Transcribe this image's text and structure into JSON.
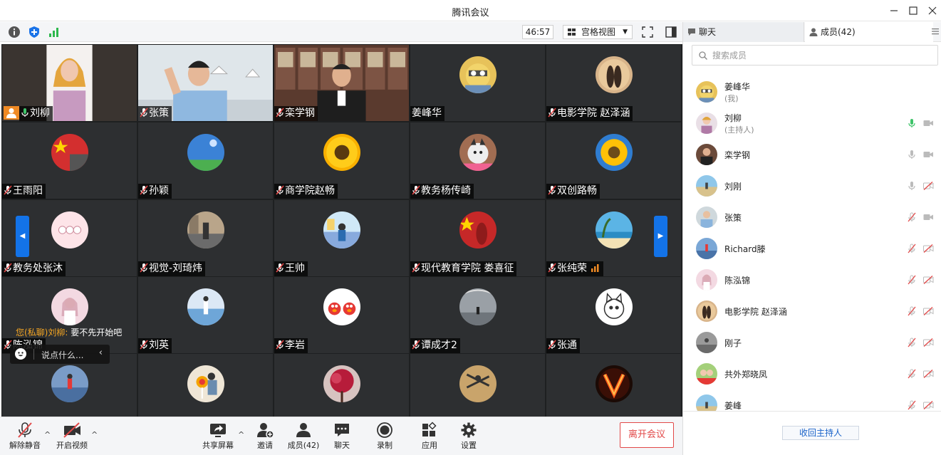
{
  "window": {
    "title": "腾讯会议"
  },
  "toolbar": {
    "timer": "46:57",
    "view_label": "宫格视图"
  },
  "tiles": [
    {
      "name": "刘柳",
      "row": 0,
      "col": 0,
      "video": "woman",
      "mic": "on",
      "host": true,
      "speaking": true
    },
    {
      "name": "张策",
      "row": 0,
      "col": 1,
      "video": "man-office",
      "mic": "muted"
    },
    {
      "name": "栾学钢",
      "row": 0,
      "col": 2,
      "video": "man-library",
      "mic": "muted"
    },
    {
      "name": "姜峰华",
      "row": 0,
      "col": 3,
      "avatar": "cartoon-yellow",
      "mic": "none"
    },
    {
      "name": "电影学院 赵泽涵",
      "row": 0,
      "col": 4,
      "avatar": "couple",
      "mic": "muted"
    },
    {
      "name": "王雨阳",
      "row": 1,
      "col": 0,
      "avatar": "flag",
      "mic": "muted"
    },
    {
      "name": "孙颖",
      "row": 1,
      "col": 1,
      "avatar": "sky-lawn",
      "mic": "muted"
    },
    {
      "name": "商学院赵畅",
      "row": 1,
      "col": 2,
      "avatar": "sunflower",
      "mic": "muted"
    },
    {
      "name": "教务杨传崎",
      "row": 1,
      "col": 3,
      "avatar": "husky",
      "mic": "muted"
    },
    {
      "name": "双创路畅",
      "row": 1,
      "col": 4,
      "avatar": "sunflower2",
      "mic": "muted"
    },
    {
      "name": "教务处张沐",
      "row": 2,
      "col": 0,
      "avatar": "cartoon-pink",
      "mic": "muted"
    },
    {
      "name": "视觉-刘琦炜",
      "row": 2,
      "col": 1,
      "avatar": "street",
      "mic": "muted"
    },
    {
      "name": "王帅",
      "row": 2,
      "col": 2,
      "avatar": "seaside-person",
      "mic": "muted"
    },
    {
      "name": "现代教育学院 娄喜征",
      "row": 2,
      "col": 3,
      "avatar": "flag-red",
      "mic": "muted"
    },
    {
      "name": "张纯荣",
      "row": 2,
      "col": 4,
      "avatar": "beach",
      "mic": "muted",
      "signal": true
    },
    {
      "name": "",
      "row": 3,
      "col": 0,
      "avatar": "girl-flowers",
      "mic": "none"
    },
    {
      "name": "刘英",
      "row": 3,
      "col": 1,
      "avatar": "sea-girl",
      "mic": "muted"
    },
    {
      "name": "李岩",
      "row": 3,
      "col": 2,
      "avatar": "elmo",
      "mic": "muted"
    },
    {
      "name": "谭成才2",
      "row": 3,
      "col": 3,
      "avatar": "hall",
      "mic": "muted"
    },
    {
      "name": "张通",
      "row": 3,
      "col": 4,
      "avatar": "cat-sketch",
      "mic": "muted"
    },
    {
      "name": "",
      "row": 4,
      "col": 0,
      "avatar": "runner",
      "mic": "none"
    },
    {
      "name": "",
      "row": 4,
      "col": 1,
      "avatar": "lollipop",
      "mic": "none"
    },
    {
      "name": "",
      "row": 4,
      "col": 2,
      "avatar": "red-tree",
      "mic": "none"
    },
    {
      "name": "",
      "row": 4,
      "col": 3,
      "avatar": "jump",
      "mic": "none"
    },
    {
      "name": "",
      "row": 4,
      "col": 4,
      "avatar": "fire-v",
      "mic": "none"
    }
  ],
  "chat_popup": {
    "from": "您(私聊)刘柳:",
    "message": "要不先开始吧",
    "behind_name": "陈泓锦"
  },
  "chat_input": {
    "placeholder": "说点什么..."
  },
  "bottom": {
    "unmute": "解除静音",
    "start_video": "开启视频",
    "share": "共享屏幕",
    "invite": "邀请",
    "members": "成员(42)",
    "chat": "聊天",
    "record": "录制",
    "apps": "应用",
    "settings": "设置",
    "leave": "离开会议"
  },
  "panel": {
    "tab_chat": "聊天",
    "tab_members": "成员(42)",
    "search_placeholder": "搜索成员",
    "reclaim_host": "收回主持人",
    "members": [
      {
        "name": "姜峰华",
        "tag": "(我)",
        "avatar": "cartoon-yellow",
        "mic": "none",
        "cam": "none"
      },
      {
        "name": "刘柳",
        "tag": "(主持人)",
        "avatar": "woman",
        "mic": "active",
        "cam": "on"
      },
      {
        "name": "栾学钢",
        "tag": "",
        "avatar": "man-library",
        "mic": "on",
        "cam": "on"
      },
      {
        "name": "刘刚",
        "tag": "",
        "avatar": "seaside",
        "mic": "on",
        "cam": "off"
      },
      {
        "name": "张策",
        "tag": "",
        "avatar": "man-office",
        "mic": "muted",
        "cam": "on"
      },
      {
        "name": "Richard滕",
        "tag": "",
        "avatar": "runner2",
        "mic": "muted",
        "cam": "off"
      },
      {
        "name": "陈泓锦",
        "tag": "",
        "avatar": "girl-flowers",
        "mic": "muted",
        "cam": "off"
      },
      {
        "name": "电影学院 赵泽涵",
        "tag": "",
        "avatar": "couple",
        "mic": "muted",
        "cam": "off"
      },
      {
        "name": "刚子",
        "tag": "",
        "avatar": "gray",
        "mic": "muted",
        "cam": "off"
      },
      {
        "name": "共外郑晓凤",
        "tag": "",
        "avatar": "kids",
        "mic": "muted",
        "cam": "off"
      },
      {
        "name": "姜峰",
        "tag": "",
        "avatar": "seaside",
        "mic": "muted",
        "cam": "off"
      }
    ]
  },
  "colors": {
    "accent": "#1373e8",
    "speaking": "#3fc46a",
    "leave": "#e24848",
    "host_badge": "#f08a24"
  }
}
